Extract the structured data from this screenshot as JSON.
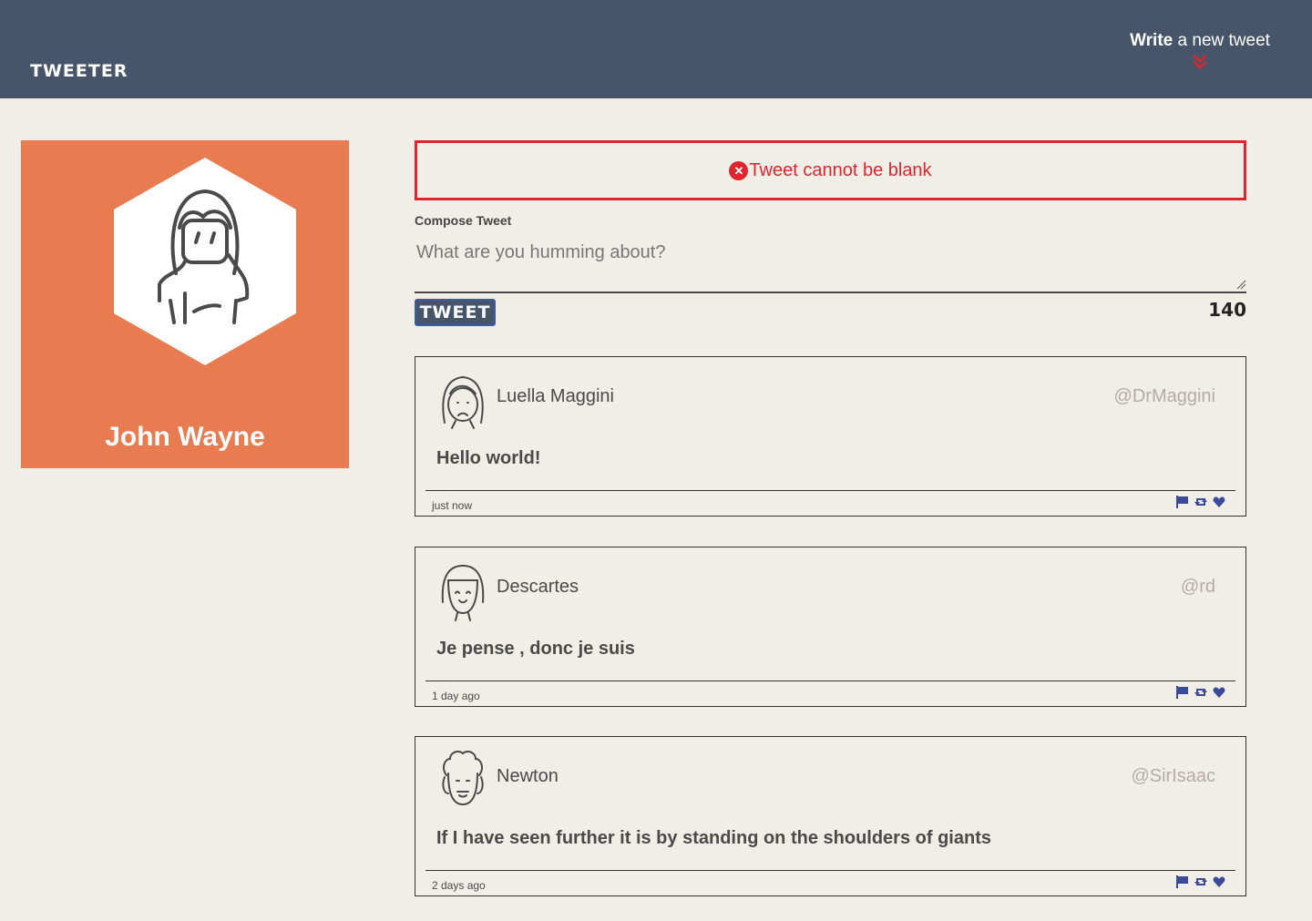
{
  "header": {
    "brand": "TWEETER",
    "write_bold": "Write",
    "write_rest": " a new tweet"
  },
  "profile": {
    "name": "John Wayne"
  },
  "error": {
    "message": "Tweet cannot be blank"
  },
  "compose": {
    "label": "Compose Tweet",
    "placeholder": "What are you humming about?",
    "button_label": "TWEET",
    "counter": "140"
  },
  "tweets": [
    {
      "author": "Luella Maggini",
      "handle": "@DrMaggini",
      "content": "Hello world!",
      "time": "just now"
    },
    {
      "author": "Descartes",
      "handle": "@rd",
      "content": "Je pense , donc je suis",
      "time": "1 day ago"
    },
    {
      "author": "Newton",
      "handle": "@SirIsaac",
      "content": "If I have seen further it is by standing on the shoulders of giants",
      "time": "2 days ago"
    }
  ],
  "colors": {
    "header": "#47556a",
    "profile": "#e97b51",
    "error": "#e1242c",
    "action_icons": "#3b4a9a"
  }
}
